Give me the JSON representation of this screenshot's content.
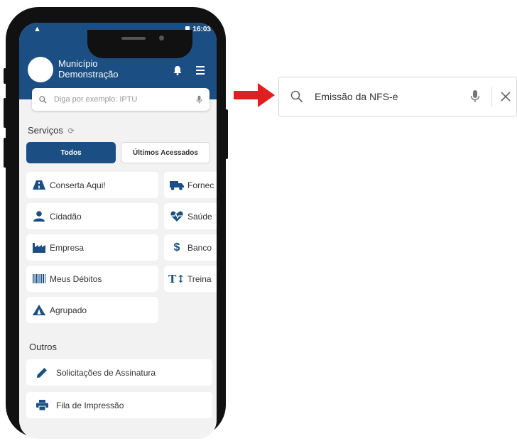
{
  "status_bar": {
    "time": "16:03",
    "signal_glyph": "▲"
  },
  "header": {
    "brand_line1": "Município",
    "brand_line2": "Demonstração",
    "bell_icon": "bell-icon",
    "menu_icon": "menu-icon"
  },
  "search": {
    "placeholder": "Diga por exemplo: IPTU"
  },
  "services": {
    "title": "Serviços",
    "tabs": [
      {
        "label": "Todos",
        "active": true
      },
      {
        "label": "Últimos Acessados",
        "active": false
      }
    ],
    "items_left": [
      {
        "label": "Conserta Aqui!",
        "icon": "road-icon"
      },
      {
        "label": "Cidadão",
        "icon": "person-icon"
      },
      {
        "label": "Empresa",
        "icon": "industry-icon"
      },
      {
        "label": "Meus Débitos",
        "icon": "barcode-icon"
      },
      {
        "label": "Agrupado",
        "icon": "tent-icon"
      }
    ],
    "items_right": [
      {
        "label": "Fornec",
        "icon": "truck-icon"
      },
      {
        "label": "Saúde",
        "icon": "heartbeat-icon"
      },
      {
        "label": "Banco",
        "icon": "dollar-icon"
      },
      {
        "label": "Treina",
        "icon": "text-height-icon"
      }
    ]
  },
  "others": {
    "title": "Outros",
    "items": [
      {
        "label": "Solicitações de Assinatura",
        "icon": "pencil-icon"
      },
      {
        "label": "Fila de Impressão",
        "icon": "printer-icon"
      }
    ]
  },
  "callout_search": {
    "value": "Emissão da NFS-e"
  },
  "colors": {
    "primary": "#1b4f83",
    "arrow": "#e02020",
    "background": "#f2f2f2"
  }
}
